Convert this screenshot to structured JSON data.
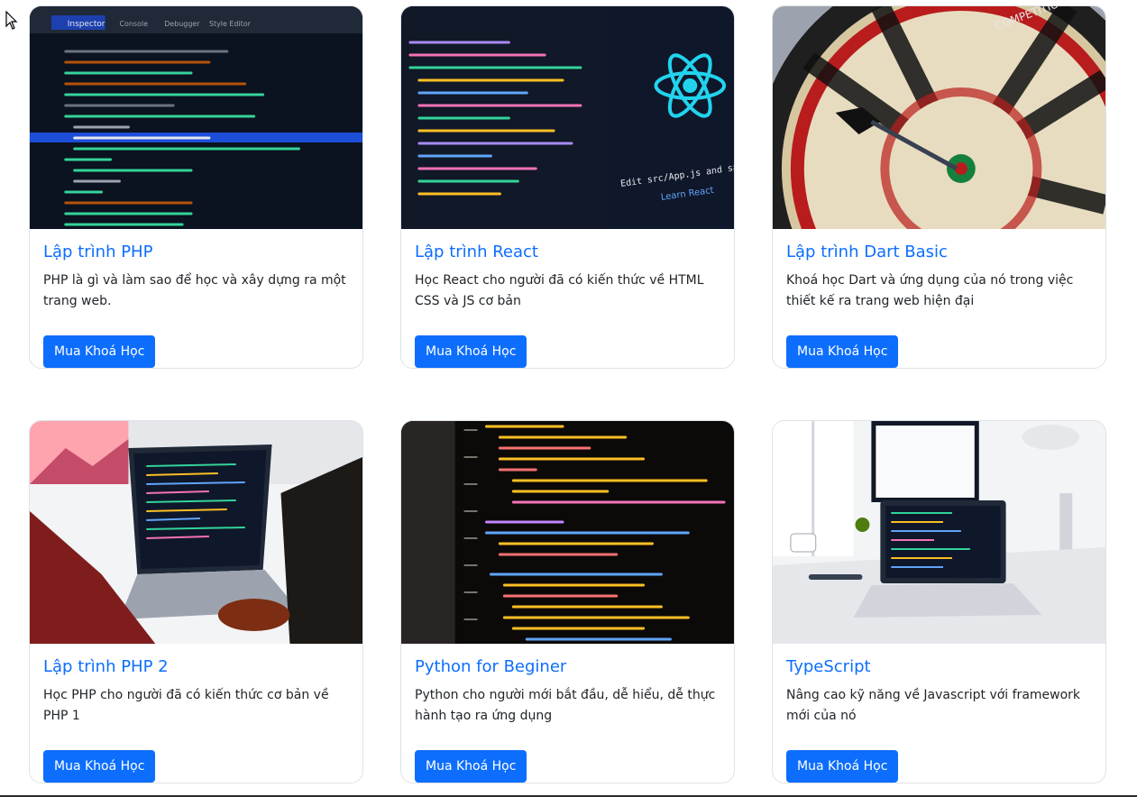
{
  "courses": [
    {
      "title": "Lập trình PHP",
      "description": "PHP là gì và làm sao để học và xây dựng ra một trang web.",
      "button": "Mua Khoá Học"
    },
    {
      "title": "Lập trình React",
      "description": "Học React cho người đã có kiến thức về HTML CSS và JS cơ bản",
      "button": "Mua Khoá Học"
    },
    {
      "title": "Lập trình Dart Basic",
      "description": "Khoá học Dart và ứng dụng của nó trong việc thiết kế ra trang web hiện đại",
      "button": "Mua Khoá Học"
    },
    {
      "title": "Lập trình PHP 2",
      "description": "Học PHP cho người đã có kiến thức cơ bản về PHP 1",
      "button": "Mua Khoá Học"
    },
    {
      "title": "Python for Beginer",
      "description": "Python cho người mới bắt đầu, dễ hiểu, dễ thực hành tạo ra ứng dụng",
      "button": "Mua Khoá Học"
    },
    {
      "title": "TypeScript",
      "description": "Nâng cao kỹ năng về Javascript với framework mới của nó",
      "button": "Mua Khoá Học"
    }
  ],
  "images": {
    "devtools": {
      "tabs": [
        "Inspector",
        "Console",
        "Debugger",
        "Style Editor"
      ]
    },
    "react": {
      "caption": "Edit src/App.js and save to reload.",
      "link": "Learn React"
    },
    "dart": {
      "board_text": "COMPETITION"
    }
  },
  "colors": {
    "accent": "#0d6efd"
  }
}
